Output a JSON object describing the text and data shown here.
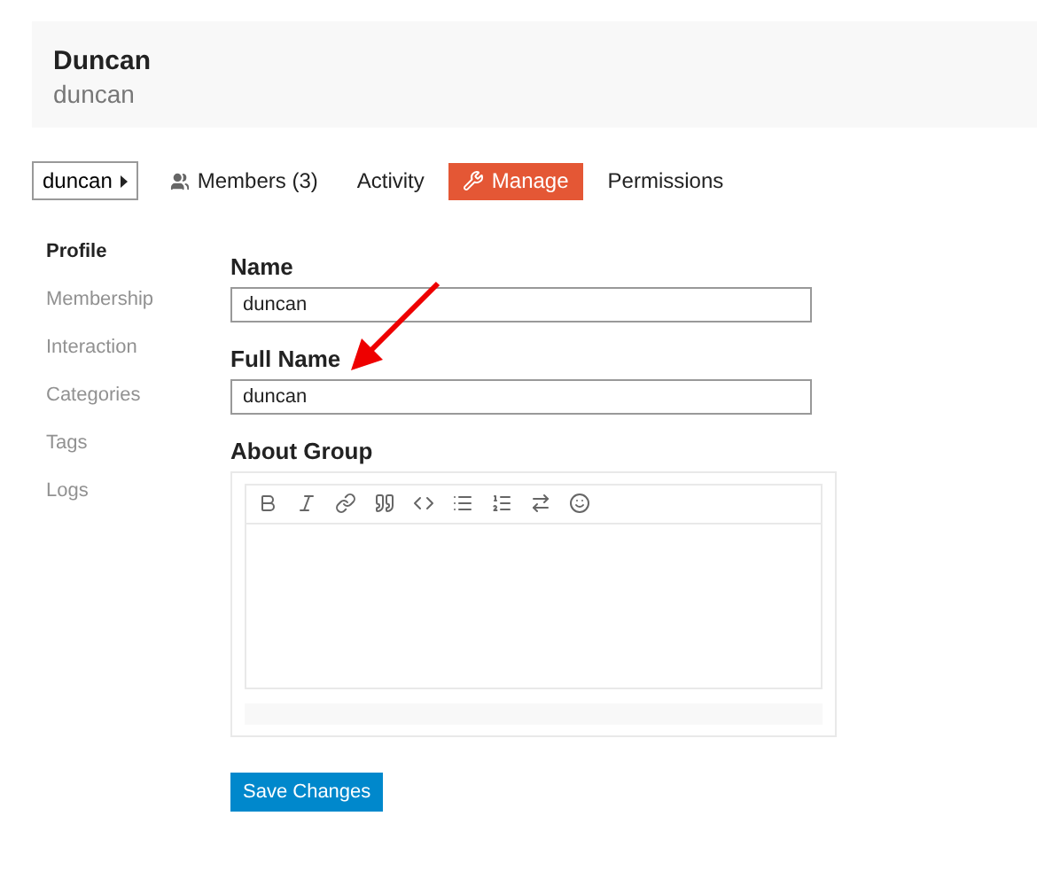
{
  "header": {
    "title": "Duncan",
    "subtitle": "duncan"
  },
  "nav": {
    "dropdown": {
      "label": "duncan"
    },
    "tabs": [
      {
        "label": "Members (3)",
        "kind": "group",
        "selected": false
      },
      {
        "label": "Activity",
        "kind": "plain",
        "selected": false
      },
      {
        "label": "Manage",
        "kind": "tool",
        "selected": true
      },
      {
        "label": "Permissions",
        "kind": "plain",
        "selected": false
      }
    ]
  },
  "sidebar": {
    "items": [
      {
        "label": "Profile",
        "selected": true
      },
      {
        "label": "Membership",
        "selected": false
      },
      {
        "label": "Interaction",
        "selected": false
      },
      {
        "label": "Categories",
        "selected": false
      },
      {
        "label": "Tags",
        "selected": false
      },
      {
        "label": "Logs",
        "selected": false
      }
    ]
  },
  "form": {
    "fields": [
      {
        "label": "Name",
        "value": "duncan"
      },
      {
        "label": "Full Name",
        "value": "duncan"
      }
    ],
    "about": {
      "label": "About Group"
    },
    "submit": "Save Changes"
  }
}
